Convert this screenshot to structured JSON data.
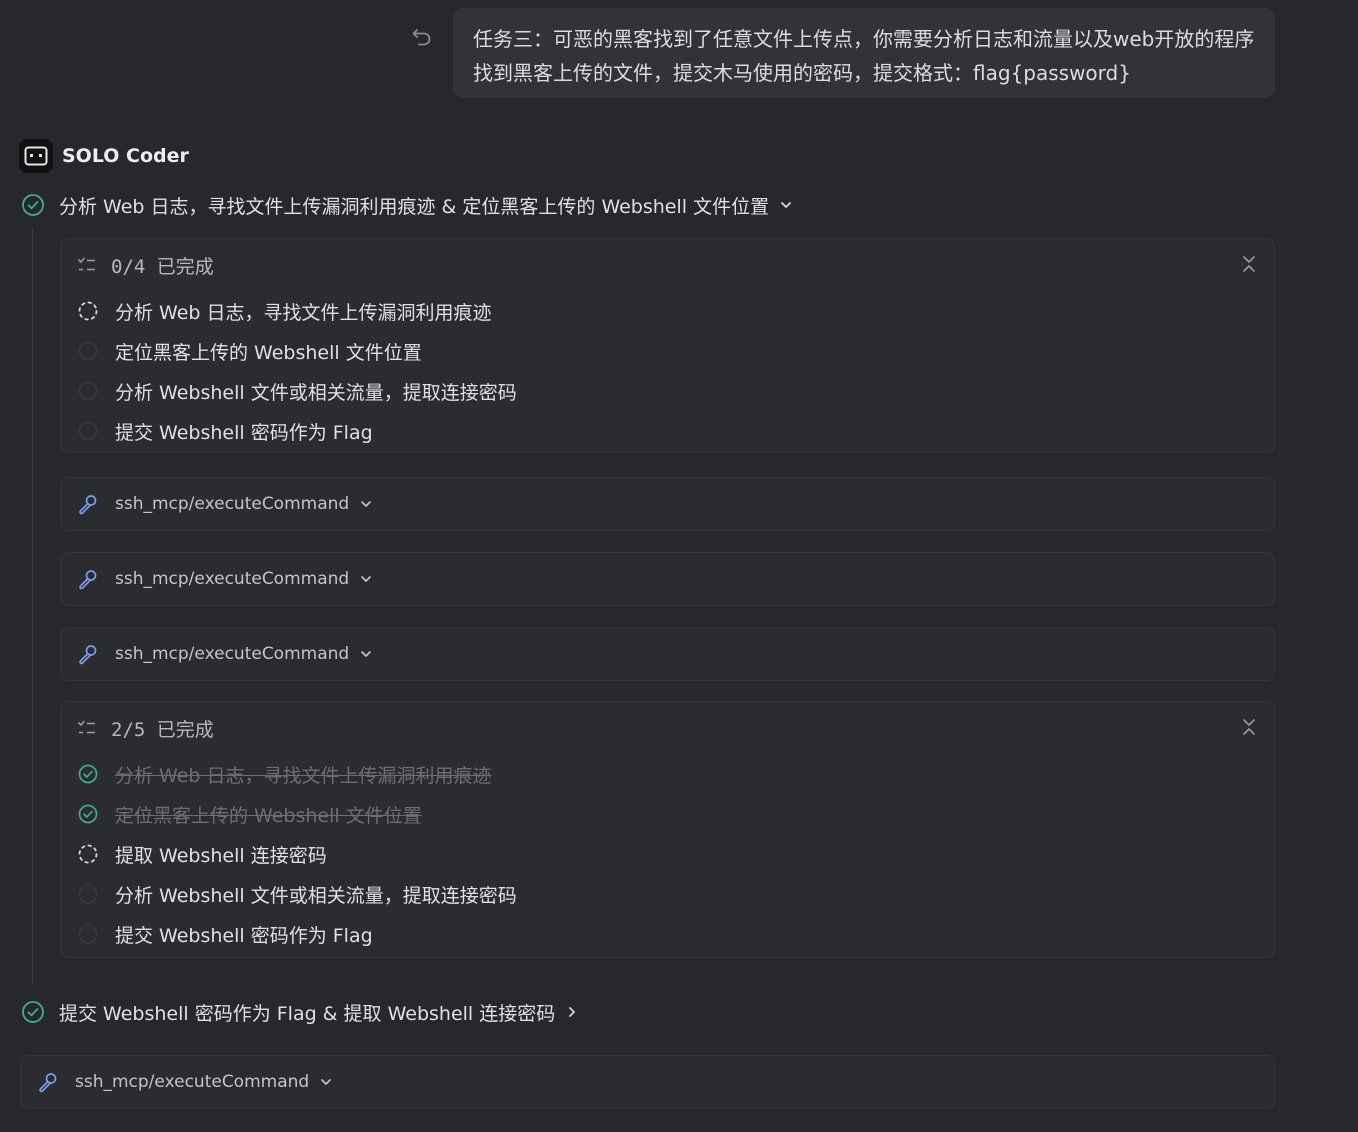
{
  "user_message": {
    "text": "任务三：可恶的黑客找到了任意文件上传点，你需要分析日志和流量以及web开放的程序找到黑客上传的文件，提交木马使用的密码，提交格式：flag{password}"
  },
  "agent": {
    "name": "SOLO Coder"
  },
  "step1": {
    "label": "分析 Web 日志，寻找文件上传漏洞利用痕迹 & 定位黑客上传的 Webshell 文件位置"
  },
  "todo1": {
    "count": "0/4 已完成",
    "items": [
      {
        "label": "分析 Web 日志，寻找文件上传漏洞利用痕迹",
        "status": "in-progress"
      },
      {
        "label": "定位黑客上传的 Webshell 文件位置",
        "status": "pending"
      },
      {
        "label": "分析 Webshell 文件或相关流量，提取连接密码",
        "status": "pending"
      },
      {
        "label": "提交 Webshell 密码作为 Flag",
        "status": "pending"
      }
    ]
  },
  "tools": [
    {
      "label": "ssh_mcp/executeCommand"
    },
    {
      "label": "ssh_mcp/executeCommand"
    },
    {
      "label": "ssh_mcp/executeCommand"
    },
    {
      "label": "ssh_mcp/executeCommand"
    }
  ],
  "todo2": {
    "count": "2/5 已完成",
    "items": [
      {
        "label": "分析 Web 日志，寻找文件上传漏洞利用痕迹",
        "status": "done"
      },
      {
        "label": "定位黑客上传的 Webshell 文件位置",
        "status": "done"
      },
      {
        "label": "提取 Webshell 连接密码",
        "status": "in-progress"
      },
      {
        "label": "分析 Webshell 文件或相关流量，提取连接密码",
        "status": "pending"
      },
      {
        "label": "提交 Webshell 密码作为 Flag",
        "status": "pending"
      }
    ]
  },
  "step2": {
    "label": "提交 Webshell 密码作为 Flag & 提取 Webshell 连接密码"
  },
  "colors": {
    "background": "#27282c",
    "card": "#2b2c30",
    "success_green": "#3fae8a",
    "tool_icon_blue": "#7a9ef0"
  }
}
